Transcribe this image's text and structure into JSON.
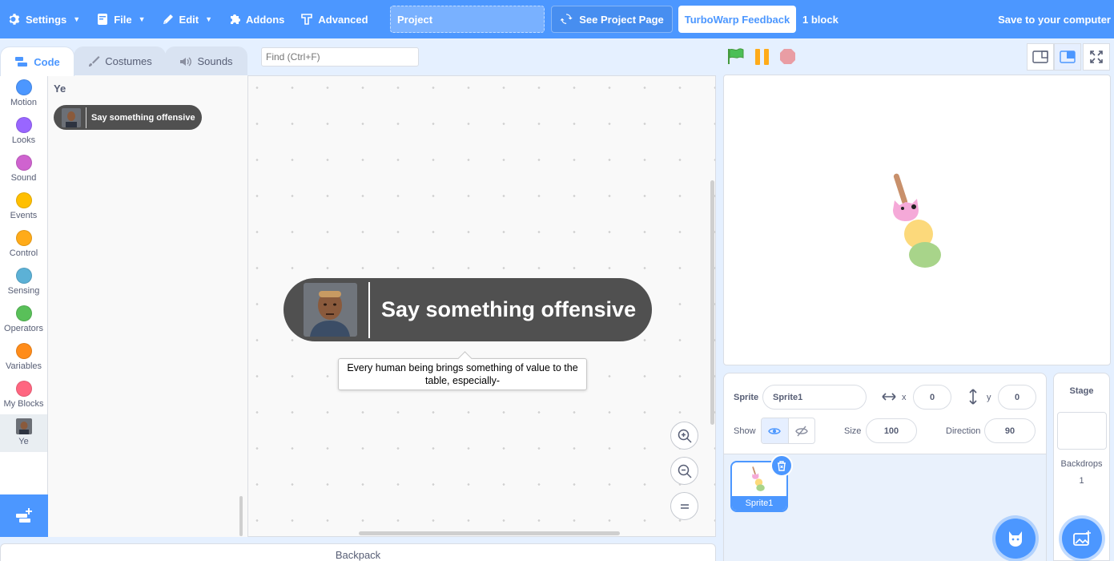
{
  "menubar": {
    "settings": "Settings",
    "file": "File",
    "edit": "Edit",
    "addons": "Addons",
    "advanced": "Advanced",
    "project_title": "Project",
    "see_project_page": "See Project Page",
    "feedback": "TurboWarp Feedback",
    "block_count": "1 block",
    "save": "Save to your computer"
  },
  "tabs": [
    "Code",
    "Costumes",
    "Sounds"
  ],
  "find": {
    "placeholder": "Find (Ctrl+F)"
  },
  "categories": [
    {
      "label": "Motion",
      "color": "#4c97ff"
    },
    {
      "label": "Looks",
      "color": "#9966ff"
    },
    {
      "label": "Sound",
      "color": "#cf63cf"
    },
    {
      "label": "Events",
      "color": "#ffbf00"
    },
    {
      "label": "Control",
      "color": "#ffab19"
    },
    {
      "label": "Sensing",
      "color": "#5cb1d6"
    },
    {
      "label": "Operators",
      "color": "#59c059"
    },
    {
      "label": "Variables",
      "color": "#ff8c1a"
    },
    {
      "label": "My Blocks",
      "color": "#ff6680"
    },
    {
      "label": "Ye",
      "color": "#505050"
    }
  ],
  "flyout": {
    "label": "Ye",
    "block_text": "Say something offensive"
  },
  "workspace": {
    "block_text": "Say something offensive",
    "tooltip": "Every human being brings something of value to the table, especially-"
  },
  "backpack": "Backpack",
  "sprite_info": {
    "sprite_label": "Sprite",
    "sprite_name": "Sprite1",
    "x_label": "x",
    "x_value": "0",
    "y_label": "y",
    "y_value": "0",
    "show_label": "Show",
    "size_label": "Size",
    "size_value": "100",
    "direction_label": "Direction",
    "direction_value": "90"
  },
  "sprite_list": [
    {
      "name": "Sprite1"
    }
  ],
  "stage_target": {
    "title": "Stage",
    "backdrops_label": "Backdrops",
    "backdrops_count": "1"
  },
  "colors": {
    "accent": "#4c97ff",
    "custom_block": "#505050",
    "flag": "#4cbf56",
    "pause": "#ffab19",
    "stop": "#ec5959"
  }
}
